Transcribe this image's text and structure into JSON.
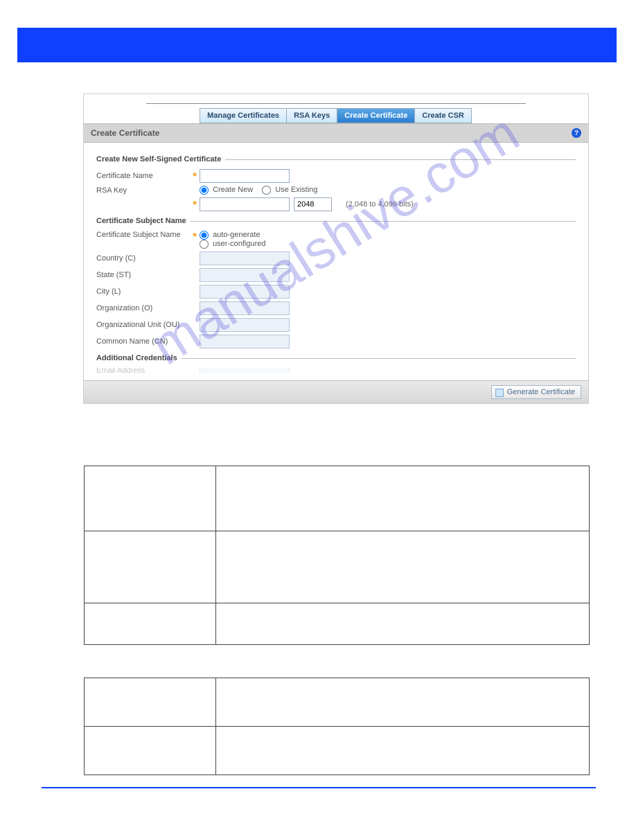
{
  "watermark": "manualshive.com",
  "tabs": {
    "manage": "Manage Certificates",
    "rsa": "RSA Keys",
    "create_cert": "Create Certificate",
    "create_csr": "Create CSR"
  },
  "section_title": "Create Certificate",
  "help_glyph": "?",
  "groups": {
    "new_cert": "Create New Self-Signed Certificate",
    "subject": "Certificate Subject Name",
    "additional": "Additional Credentials"
  },
  "labels": {
    "cert_name": "Certificate Name",
    "rsa_key": "RSA Key",
    "create_new": "Create New",
    "use_existing": "Use Existing",
    "bits_default": "2048",
    "bits_hint": "(2,048 to 4,096 bits)",
    "subject_name": "Certificate Subject Name",
    "auto_generate": "auto-generate",
    "user_configured": "user-configured",
    "country": "Country (C)",
    "state": "State (ST)",
    "city": "City (L)",
    "org": "Organization (O)",
    "ou": "Organizational Unit (OU)",
    "cn": "Common Name (CN)",
    "email": "Email Address"
  },
  "buttons": {
    "generate": "Generate Certificate"
  }
}
